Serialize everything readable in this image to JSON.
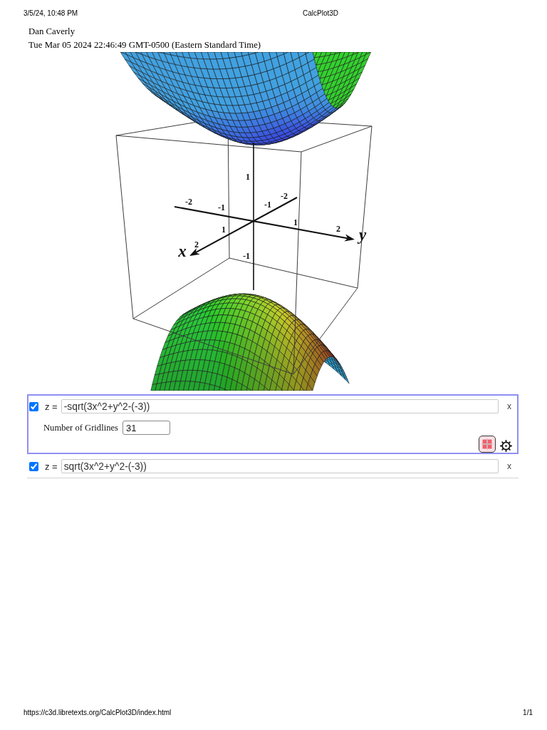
{
  "print_header": {
    "date": "3/5/24, 10:48 PM",
    "title": "CalcPlot3D"
  },
  "author": "Dan Caverly",
  "timestamp": "Tue Mar 05 2024 22:46:49 GMT-0500 (Eastern Standard Time)",
  "plot": {
    "x_axis": {
      "title": "x",
      "ticks": [
        "-2",
        "-1",
        "1",
        "2"
      ]
    },
    "y_axis": {
      "title": "y",
      "ticks": [
        "-2",
        "-1",
        "1",
        "2"
      ]
    },
    "z_axis": {
      "ticks": [
        "1",
        "-1"
      ]
    }
  },
  "surfaces": [
    {
      "checked": true,
      "selected": true,
      "label": "z =",
      "expression": "-sqrt(3x^2+y^2-(-3))",
      "gridlines_label": "Number of Gridlines",
      "gridlines": "31",
      "remove": "x"
    },
    {
      "checked": true,
      "selected": false,
      "label": "z =",
      "expression": "sqrt(3x^2+y^2-(-3))",
      "remove": "x"
    }
  ],
  "print_footer": {
    "url": "https://c3d.libretexts.org/CalcPlot3D/index.html",
    "page": "1/1"
  }
}
